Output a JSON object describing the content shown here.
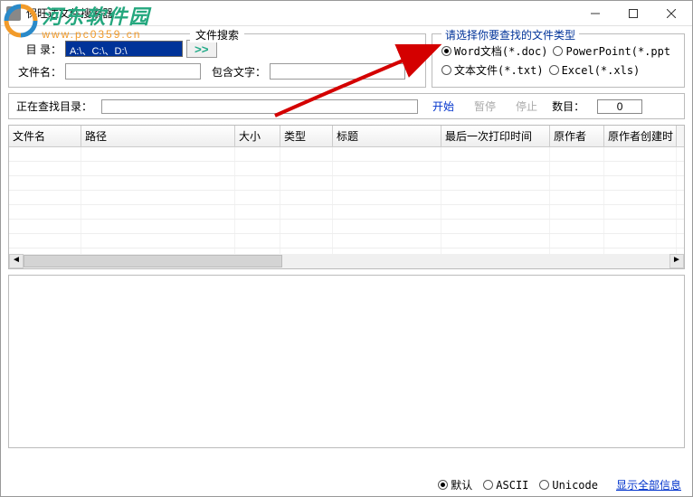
{
  "window": {
    "title": "保旺达文件搜索器"
  },
  "watermark": {
    "main": "河东软件园",
    "sub": "www.pc0359.cn"
  },
  "search": {
    "section_title": "文件搜索",
    "dir_label": "目 录：",
    "dir_value": "A:\\、C:\\、D:\\",
    "browse_label": ">>",
    "name_label": "文件名：",
    "name_value": "",
    "contain_label": "包含文字：",
    "contain_value": ""
  },
  "filetype": {
    "title": "请选择你要查找的文件类型",
    "options": [
      {
        "label": "Word文档(*.doc)",
        "checked": true
      },
      {
        "label": "PowerPoint(*.ppt",
        "checked": false
      },
      {
        "label": "文本文件(*.txt)",
        "checked": false
      },
      {
        "label": "Excel(*.xls)",
        "checked": false
      }
    ]
  },
  "status": {
    "label": "正在查找目录：",
    "start": "开始",
    "pause": "暂停",
    "stop": "停止",
    "count_label": "数目：",
    "count_value": "0"
  },
  "table": {
    "columns": [
      "文件名",
      "路径",
      "大小",
      "类型",
      "标题",
      "最后一次打印时间",
      "原作者",
      "原作者创建时"
    ],
    "widths": [
      80,
      170,
      50,
      58,
      120,
      120,
      60,
      80
    ]
  },
  "encoding": {
    "options": [
      {
        "label": "默认",
        "checked": true
      },
      {
        "label": "ASCII",
        "checked": false
      },
      {
        "label": "Unicode",
        "checked": false
      }
    ],
    "show_all": "显示全部信息"
  }
}
